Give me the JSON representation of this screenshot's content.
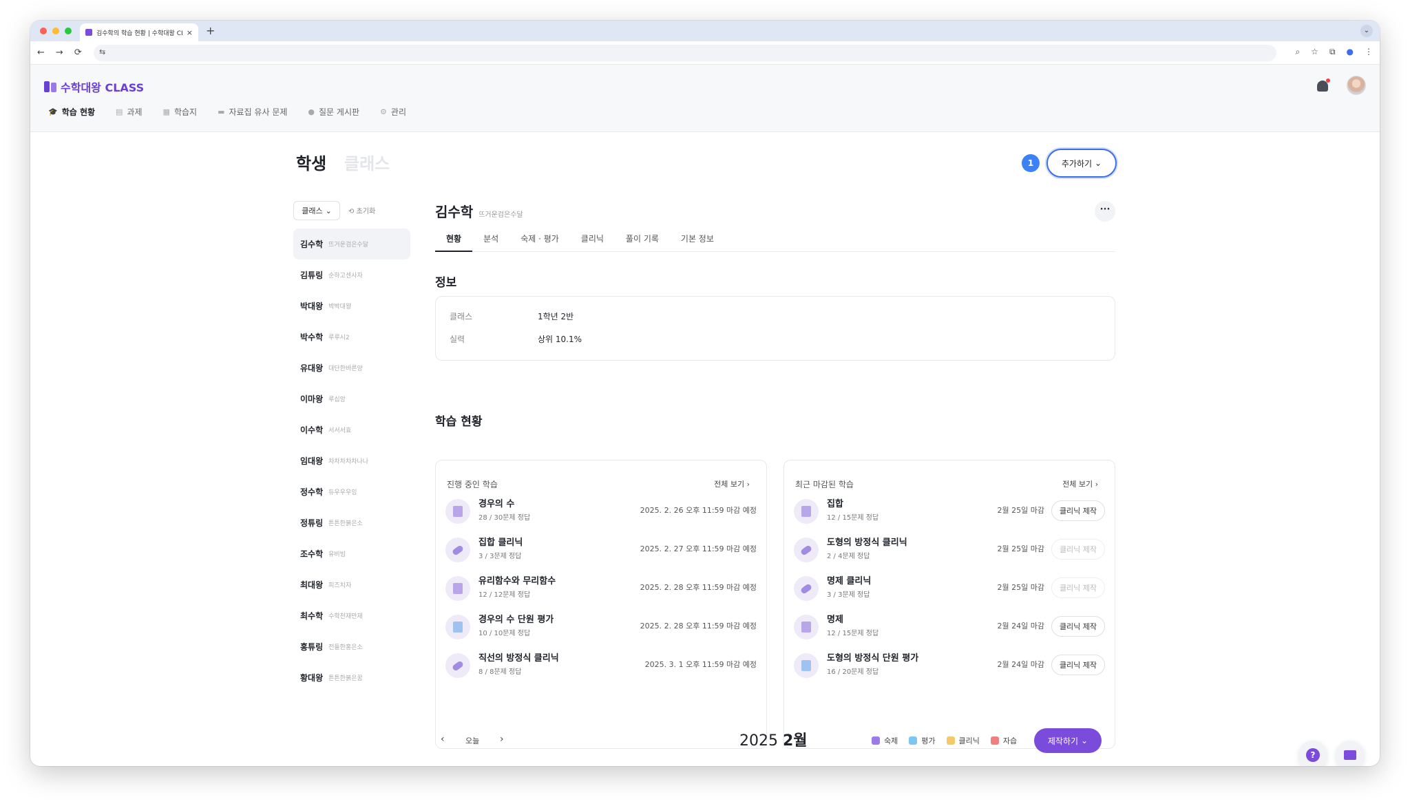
{
  "browser": {
    "tab_title": "김수학의 학습 현황 | 수학대왕 CLASS",
    "tab_close": "×",
    "new_tab": "+",
    "tab_list": "⌄",
    "back": "←",
    "forward": "→",
    "reload": "⟳",
    "site_info": "⇆",
    "zoom": "⌕",
    "star": "☆",
    "extensions": "⧉",
    "profile": "●",
    "menu": "⋮",
    "light_colors": [
      "#ff5f57",
      "#febc2e",
      "#28c840"
    ]
  },
  "app": {
    "logo_text": "수학대왕 CLASS",
    "brand_color": "#6a3fd6",
    "nav": [
      {
        "label": "학습 현황",
        "icon": "graduation-cap-icon",
        "glyph": "🎓",
        "active": true
      },
      {
        "label": "과제",
        "icon": "document-icon",
        "glyph": "▤",
        "active": false
      },
      {
        "label": "학습지",
        "icon": "worksheet-icon",
        "glyph": "▦",
        "active": false
      },
      {
        "label": "자료집 유사 문제",
        "icon": "folder-icon",
        "glyph": "▬",
        "active": false
      },
      {
        "label": "질문 게시판",
        "icon": "chat-icon",
        "glyph": "●",
        "active": false
      },
      {
        "label": "관리",
        "icon": "gear-icon",
        "glyph": "⚙",
        "active": false
      }
    ]
  },
  "page": {
    "title": "학생",
    "title_inactive": "클래스",
    "badge_count": "1",
    "add_button": "추가하기",
    "chevron": "⌄",
    "filter_label": "클래스",
    "reset_label": "⟲ 초기화"
  },
  "students": [
    {
      "name": "김수학",
      "nick": "뜨거운검은수달",
      "active": true
    },
    {
      "name": "김튜링",
      "nick": "순하고센사자",
      "active": false
    },
    {
      "name": "박대왕",
      "nick": "박박대왕",
      "active": false
    },
    {
      "name": "박수학",
      "nick": "루루시2",
      "active": false
    },
    {
      "name": "유대왕",
      "nick": "대단한바른양",
      "active": false
    },
    {
      "name": "이마왕",
      "nick": "루십앙",
      "active": false
    },
    {
      "name": "이수학",
      "nick": "서서서효",
      "active": false
    },
    {
      "name": "임대왕",
      "nick": "차차차차차나나",
      "active": false
    },
    {
      "name": "정수학",
      "nick": "듀우우우잉",
      "active": false
    },
    {
      "name": "정튜링",
      "nick": "튼튼한붉은소",
      "active": false
    },
    {
      "name": "조수학",
      "nick": "유비빔",
      "active": false
    },
    {
      "name": "최대왕",
      "nick": "피즈치자",
      "active": false
    },
    {
      "name": "최수학",
      "nick": "수학천재만재",
      "active": false
    },
    {
      "name": "홍튜링",
      "nick": "전들한홍은소",
      "active": false
    },
    {
      "name": "황대왕",
      "nick": "튼튼한붉은꿈",
      "active": false
    }
  ],
  "detail": {
    "name": "김수학",
    "nick": "뜨거운검은수달",
    "more": "···",
    "tabs": [
      "현황",
      "분석",
      "숙제 · 평가",
      "클리닉",
      "풀이 기록",
      "기본 정보"
    ],
    "info_heading": "정보",
    "info": [
      {
        "label": "클래스",
        "value": "1학년 2반"
      },
      {
        "label": "실력",
        "value": "상위 10.1%"
      }
    ],
    "study_heading": "학습 현황",
    "ongoing": {
      "title": "진행 중인 학습",
      "see_all": "전체 보기  ›",
      "items": [
        {
          "title": "경우의 수",
          "sub": "28 / 30문제 정답",
          "date": "2025. 2. 26 오후 11:59 마감 예정",
          "icon": "book-icon"
        },
        {
          "title": "집합 클리닉",
          "sub": "3 / 3문제 정답",
          "date": "2025. 2. 27 오후 11:59 마감 예정",
          "icon": "pill-icon"
        },
        {
          "title": "유리함수와 무리함수",
          "sub": "12 / 12문제 정답",
          "date": "2025. 2. 28 오후 11:59 마감 예정",
          "icon": "book-icon"
        },
        {
          "title": "경우의 수 단원 평가",
          "sub": "10 / 10문제 정답",
          "date": "2025. 2. 28 오후 11:59 마감 예정",
          "icon": "test-icon"
        },
        {
          "title": "직선의 방정식 클리닉",
          "sub": "8 / 8문제 정답",
          "date": "2025. 3. 1 오후 11:59 마감 예정",
          "icon": "pill-icon"
        }
      ]
    },
    "recent": {
      "title": "최근 마감된 학습",
      "see_all": "전체 보기  ›",
      "items": [
        {
          "title": "집합",
          "sub": "12 / 15문제 정답",
          "date": "2월 25일 마감",
          "button": "클리닉 제작",
          "enabled": true,
          "icon": "book-icon"
        },
        {
          "title": "도형의 방정식 클리닉",
          "sub": "2 / 4문제 정답",
          "date": "2월 25일 마감",
          "button": "클리닉 제작",
          "enabled": false,
          "icon": "pill-icon"
        },
        {
          "title": "명제 클리닉",
          "sub": "3 / 3문제 정답",
          "date": "2월 25일 마감",
          "button": "클리닉 제작",
          "enabled": false,
          "icon": "pill-icon"
        },
        {
          "title": "명제",
          "sub": "12 / 15문제 정답",
          "date": "2월 24일 마감",
          "button": "클리닉 제작",
          "enabled": true,
          "icon": "book-icon"
        },
        {
          "title": "도형의 방정식 단원 평가",
          "sub": "16 / 20문제 정답",
          "date": "2월 24일 마감",
          "button": "클리닉 제작",
          "enabled": true,
          "icon": "test-icon"
        }
      ]
    }
  },
  "calendar": {
    "prev": "‹",
    "today": "오늘",
    "next": "›",
    "year": "2025",
    "month": "2월",
    "legend": [
      {
        "label": "숙제",
        "color": "#9b7be8"
      },
      {
        "label": "평가",
        "color": "#7cc7f2"
      },
      {
        "label": "클리닉",
        "color": "#f5c96a"
      },
      {
        "label": "자습",
        "color": "#f08080"
      }
    ],
    "make_button": "제작하기"
  },
  "fab": {
    "help": "?"
  }
}
